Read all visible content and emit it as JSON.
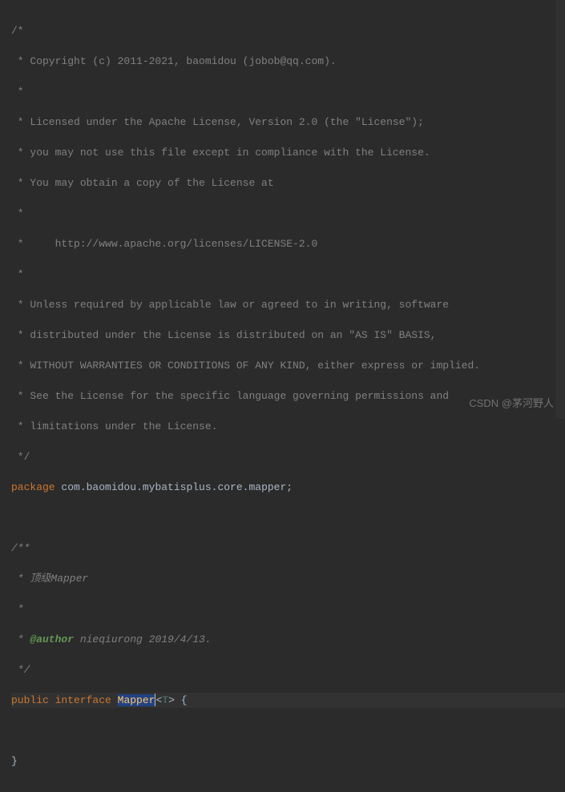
{
  "code": {
    "lines": [
      "/*",
      " * Copyright (c) 2011-2021, baomidou (jobob@qq.com).",
      " *",
      " * Licensed under the Apache License, Version 2.0 (the \"License\");",
      " * you may not use this file except in compliance with the License.",
      " * You may obtain a copy of the License at",
      " *",
      " *     http://www.apache.org/licenses/LICENSE-2.0",
      " *",
      " * Unless required by applicable law or agreed to in writing, software",
      " * distributed under the License is distributed on an \"AS IS\" BASIS,",
      " * WITHOUT WARRANTIES OR CONDITIONS OF ANY KIND, either express or implied.",
      " * See the License for the specific language governing permissions and",
      " * limitations under the License.",
      " */"
    ],
    "package_keyword": "package",
    "package_name": "com.baomidou.mybatisplus.core.mapper",
    "semicolon": ";",
    "doc_open": "/**",
    "doc_desc": " * 顶级Mapper",
    "doc_blank": " *",
    "doc_author_tag": "@author",
    "doc_author_text": " nieqiurong 2019/4/13.",
    "doc_close": " */",
    "public_kw": "public",
    "interface_kw": "interface",
    "interface_name": "Mapper",
    "type_param_open": "<",
    "type_param": "T",
    "type_param_close": ">",
    "open_brace": " {",
    "close_brace": "}"
  },
  "watermark": "CSDN @茅河野人"
}
